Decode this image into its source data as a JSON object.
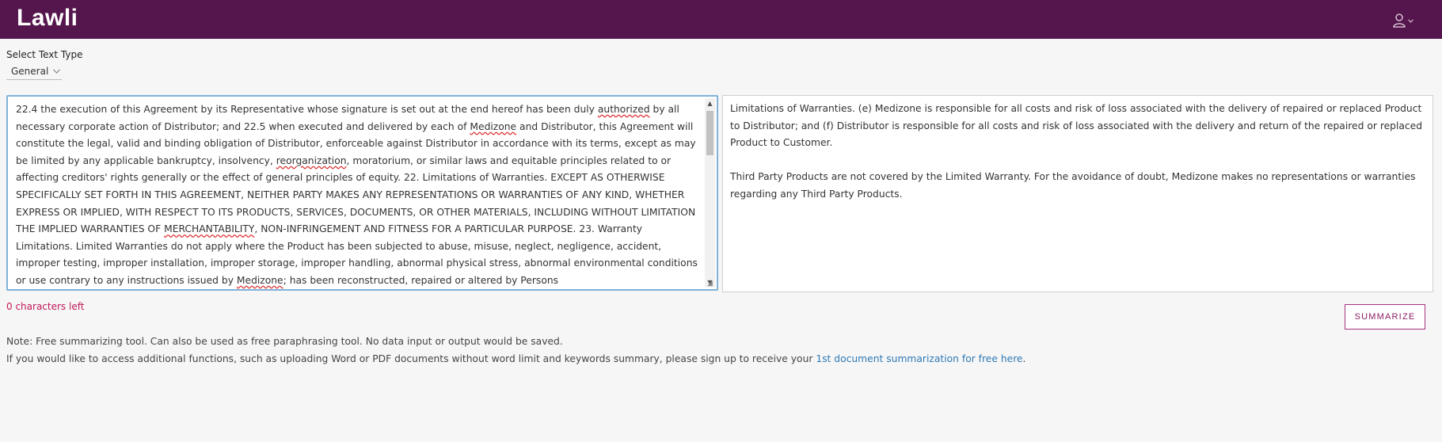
{
  "app": {
    "brand": "Lawli"
  },
  "icons": {
    "user": "user-icon",
    "chevron": "chevron-down-icon"
  },
  "text_type": {
    "label": "Select Text Type",
    "selected": "General"
  },
  "input": {
    "segments": [
      "22.4 the execution of this Agreement by its Representative whose signature is set out at the end hereof has been duly ",
      "authorized",
      " by all necessary corporate action of Distributor; and 22.5 when executed and delivered by each of ",
      "Medizone",
      " and Distributor, this Agreement will constitute the legal, valid and binding obligation of Distributor, enforceable against Distributor in accordance with its terms, except as may be limited by any applicable bankruptcy, insolvency, ",
      "reorganization",
      ", moratorium, or similar laws and equitable principles related to or affecting creditors' rights generally or the effect of general principles of equity. 22. Limitations of Warranties. EXCEPT AS OTHERWISE SPECIFICALLY SET FORTH IN THIS AGREEMENT, NEITHER PARTY MAKES ANY REPRESENTATIONS OR WARRANTIES OF ANY KIND, WHETHER EXPRESS OR IMPLIED, WITH RESPECT TO ITS PRODUCTS, SERVICES, DOCUMENTS, OR OTHER MATERIALS, INCLUDING WITHOUT LIMITATION THE IMPLIED WARRANTIES OF ",
      "MERCHANTABILITY",
      ", NON-INFRINGEMENT AND FITNESS FOR A PARTICULAR PURPOSE. 23. Warranty Limitations. Limited Warranties do not apply where the Product has been subjected to abuse, misuse, neglect, negligence, accident, improper testing, improper installation, improper storage, improper handling, abnormal physical stress, abnormal environmental conditions or use contrary to any instructions issued by ",
      "Medizone",
      "; has been reconstructed, repaired or altered by Persons"
    ]
  },
  "output": {
    "paragraph1": "Limitations of Warranties. (e) Medizone is responsible for all costs and risk of loss associated with the delivery of repaired or replaced Product to Distributor; and (f) Distributor is responsible for all costs and risk of loss associated with the delivery and return of the repaired or replaced Product to Customer.",
    "paragraph2": "Third Party Products are not covered by the Limited Warranty. For the avoidance of doubt, Medizone makes no representations or warranties regarding any Third Party Products."
  },
  "chars_left": "0 characters left",
  "summarize_label": "SUMMARIZE",
  "notes": {
    "line1": "Note: Free summarizing tool. Can also be used as free paraphrasing tool. No data input or output would be saved.",
    "line2_prefix": "If you would like to access additional functions, such as uploading Word or PDF documents without word limit and keywords summary, please sign up to receive your ",
    "line2_link": "1st document summarization for free here",
    "line2_suffix": "."
  },
  "colors": {
    "header": "#55154d",
    "accent": "#a8327e",
    "link": "#2f79b5",
    "chars_left": "#c2185b"
  }
}
